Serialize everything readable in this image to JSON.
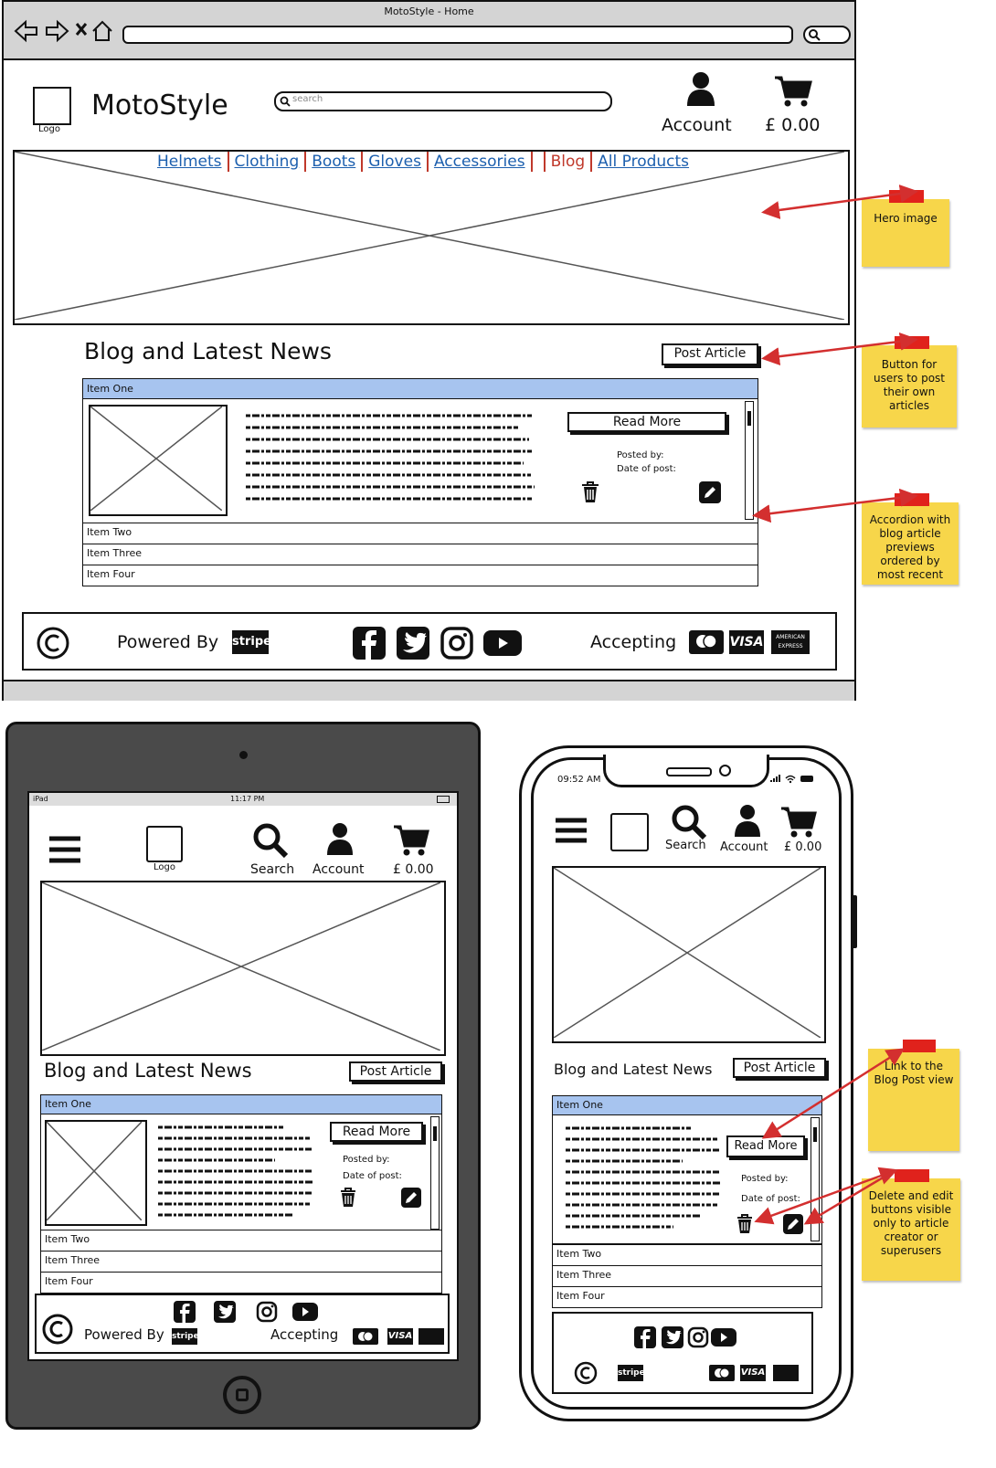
{
  "desktop": {
    "window_title": "MotoStyle - Home",
    "logo_label": "Logo",
    "brand": "MotoStyle",
    "search_placeholder": "search",
    "account": "Account",
    "cart": "£ 0.00",
    "nav": [
      "Helmets",
      "Clothing",
      "Boots",
      "Gloves",
      "Accessories",
      "Blog",
      "All Products"
    ],
    "section_title": "Blog and Latest News",
    "post_article": "Post Article",
    "accordion": [
      "Item One",
      "Item Two",
      "Item Three",
      "Item Four"
    ],
    "read_more": "Read More",
    "posted_by": "Posted by:",
    "date_of_post": "Date of post:",
    "powered_by": "Powered By",
    "stripe": "stripe",
    "accepting": "Accepting",
    "visa": "VISA",
    "amex": "AMERICAN EXPRESS"
  },
  "tablet": {
    "status_left": "iPad",
    "status_time": "11:17 PM",
    "logo_label": "Logo",
    "search": "Search",
    "account": "Account",
    "cart": "£ 0.00",
    "section_title": "Blog and Latest News",
    "post_article": "Post Article",
    "accordion": [
      "Item One",
      "Item Two",
      "Item Three",
      "Item Four"
    ],
    "read_more": "Read More",
    "posted_by": "Posted by:",
    "date_of_post": "Date of post:",
    "powered_by": "Powered By",
    "stripe": "stripe",
    "accepting": "Accepting",
    "visa": "VISA"
  },
  "phone": {
    "status_time": "09:52 AM",
    "search": "Search",
    "account": "Account",
    "cart": "£ 0.00",
    "section_title": "Blog and Latest News",
    "post_article": "Post Article",
    "accordion": [
      "Item One",
      "Item Two",
      "Item Three",
      "Item Four"
    ],
    "read_more": "Read More",
    "posted_by": "Posted by:",
    "date_of_post": "Date of post:",
    "stripe": "stripe",
    "visa": "VISA"
  },
  "notes": {
    "hero": "Hero image",
    "post_button": "Button for users to post their own articles",
    "accordion": "Accordion with blog article previews ordered by most recent",
    "blog_link": "Link to the Blog Post view",
    "delete_edit": "Delete and edit buttons visible only to article creator or superusers"
  },
  "colors": {
    "accent_link": "#1c5fae",
    "accent_active": "#c0392b",
    "accordion_header": "#a7c4ef",
    "sticky": "#f7d64a",
    "arrow": "#d32f2f",
    "device": "#4a4a4a"
  }
}
